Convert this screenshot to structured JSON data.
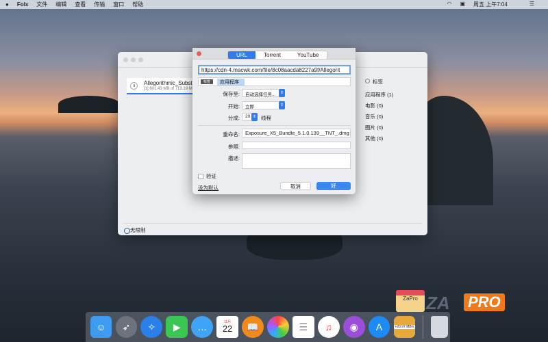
{
  "menubar": {
    "apple": "",
    "app": "Folx",
    "items": [
      "文件",
      "编辑",
      "查看",
      "传输",
      "窗口",
      "帮助"
    ],
    "clock": "周五 上午7:04"
  },
  "main": {
    "download": {
      "name": "Allegorithmic_Substa",
      "progress": "[1] 601.43 MB of 713.19 M"
    },
    "tags_header": "标签",
    "tags": [
      "应用程序 (1)",
      "电影 (0)",
      "音乐 (0)",
      "图片 (0)",
      "其他 (0)"
    ],
    "speed": "无限制"
  },
  "dialog": {
    "tabs": [
      "URL",
      "Torrent",
      "YouTube"
    ],
    "url": "https://cdn-4.macwk.com/file/8c08aacda8227a9f/Allegorit",
    "tag_badge": "标签",
    "tag_value": "应用程序",
    "save_label": "保存至:",
    "save_value": "自动选择任务...",
    "start_label": "开始:",
    "start_value": "立即",
    "split_label": "分成:",
    "split_value": "20",
    "threads": "线程",
    "rename_label": "重命名:",
    "rename_value": "Exposure_X5_Bundle_5.1.0.139__TNT_.dmg",
    "ref_label": "参照:",
    "desc_label": "描述:",
    "auth": "验证",
    "default": "设为默认",
    "cancel": "取消",
    "ok": "好"
  },
  "dock": {
    "calendar_month": "11月",
    "calendar_day": "22",
    "speed_badge": "+20.97 MB/s"
  },
  "watermark": {
    "za": "ZA",
    "pro": "PRO",
    "shop": "ZaPro"
  }
}
